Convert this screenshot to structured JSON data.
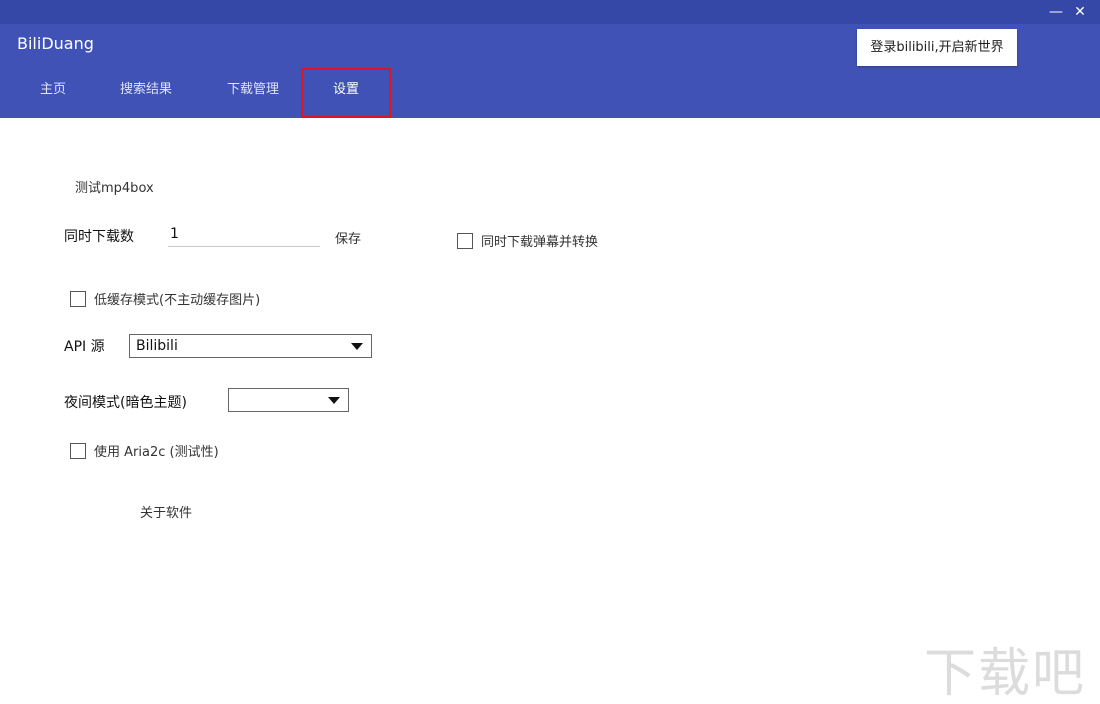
{
  "window": {
    "minimize_glyph": "—",
    "close_glyph": "✕"
  },
  "header": {
    "app_title": "BiliDuang",
    "login_label": "登录bilibili,开启新世界",
    "tabs": [
      {
        "label": "主页"
      },
      {
        "label": "搜索结果"
      },
      {
        "label": "下载管理"
      },
      {
        "label": "设置",
        "active": true
      }
    ]
  },
  "settings": {
    "test_mp4box_label": "测试mp4box",
    "concurrent_label": "同时下载数",
    "concurrent_value": "1",
    "save_label": "保存",
    "danmaku_label": "同时下载弹幕并转换",
    "danmaku_checked": false,
    "low_cache_label": "低缓存模式(不主动缓存图片)",
    "low_cache_checked": false,
    "api_label": "API 源",
    "api_value": "Bilibili",
    "night_label": "夜间模式(暗色主题)",
    "night_value": "",
    "aria_label": "使用 Aria2c  (测试性)",
    "aria_checked": false,
    "about_label": "关于软件"
  },
  "colors": {
    "titlebar": "#3548a8",
    "header": "#4052b6",
    "highlight": "#e0141f"
  },
  "watermark": "下载吧"
}
